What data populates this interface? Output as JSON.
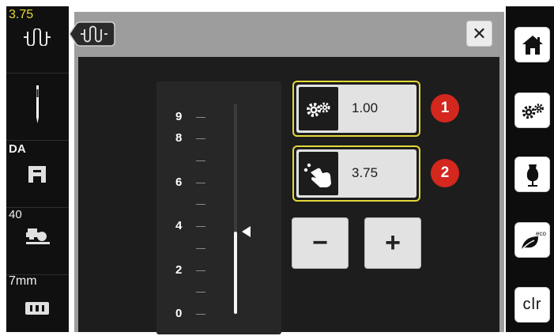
{
  "left_sidebar": {
    "tension_value": "3.75",
    "tension_icon": "thread-tension-icon",
    "needle_icon": "needle-icon",
    "foot_label": "DA",
    "foot_icon": "presser-foot-icon",
    "pressure_value": "40",
    "pressure_icon": "presser-foot-pressure-icon",
    "plate_value": "7mm",
    "plate_icon": "stitch-plate-icon"
  },
  "dialog": {
    "tab_icon": "thread-tension-icon",
    "close_label": "✕"
  },
  "scale": {
    "labels": [
      "9",
      "8",
      "6",
      "4",
      "2",
      "0"
    ],
    "min": 0,
    "max": 9.6,
    "current": 3.75
  },
  "basic_setting": {
    "icon": "gears-icon",
    "value": "1.00",
    "badge": "1"
  },
  "modified_setting": {
    "icon": "hand-tap-icon",
    "value": "3.75",
    "badge": "2"
  },
  "stepper": {
    "minus_label": "−",
    "plus_label": "+"
  },
  "right_sidebar": {
    "home_icon": "home-icon",
    "setup_icon": "gears-icon",
    "tutorial_icon": "dress-form-icon",
    "eco_icon": "eco-leaf-icon",
    "eco_label": "eco",
    "clr_label": "clr"
  },
  "colors": {
    "highlight_border": "#e4d83a",
    "badge": "#d4271e",
    "tension_value": "#e8d83a"
  }
}
